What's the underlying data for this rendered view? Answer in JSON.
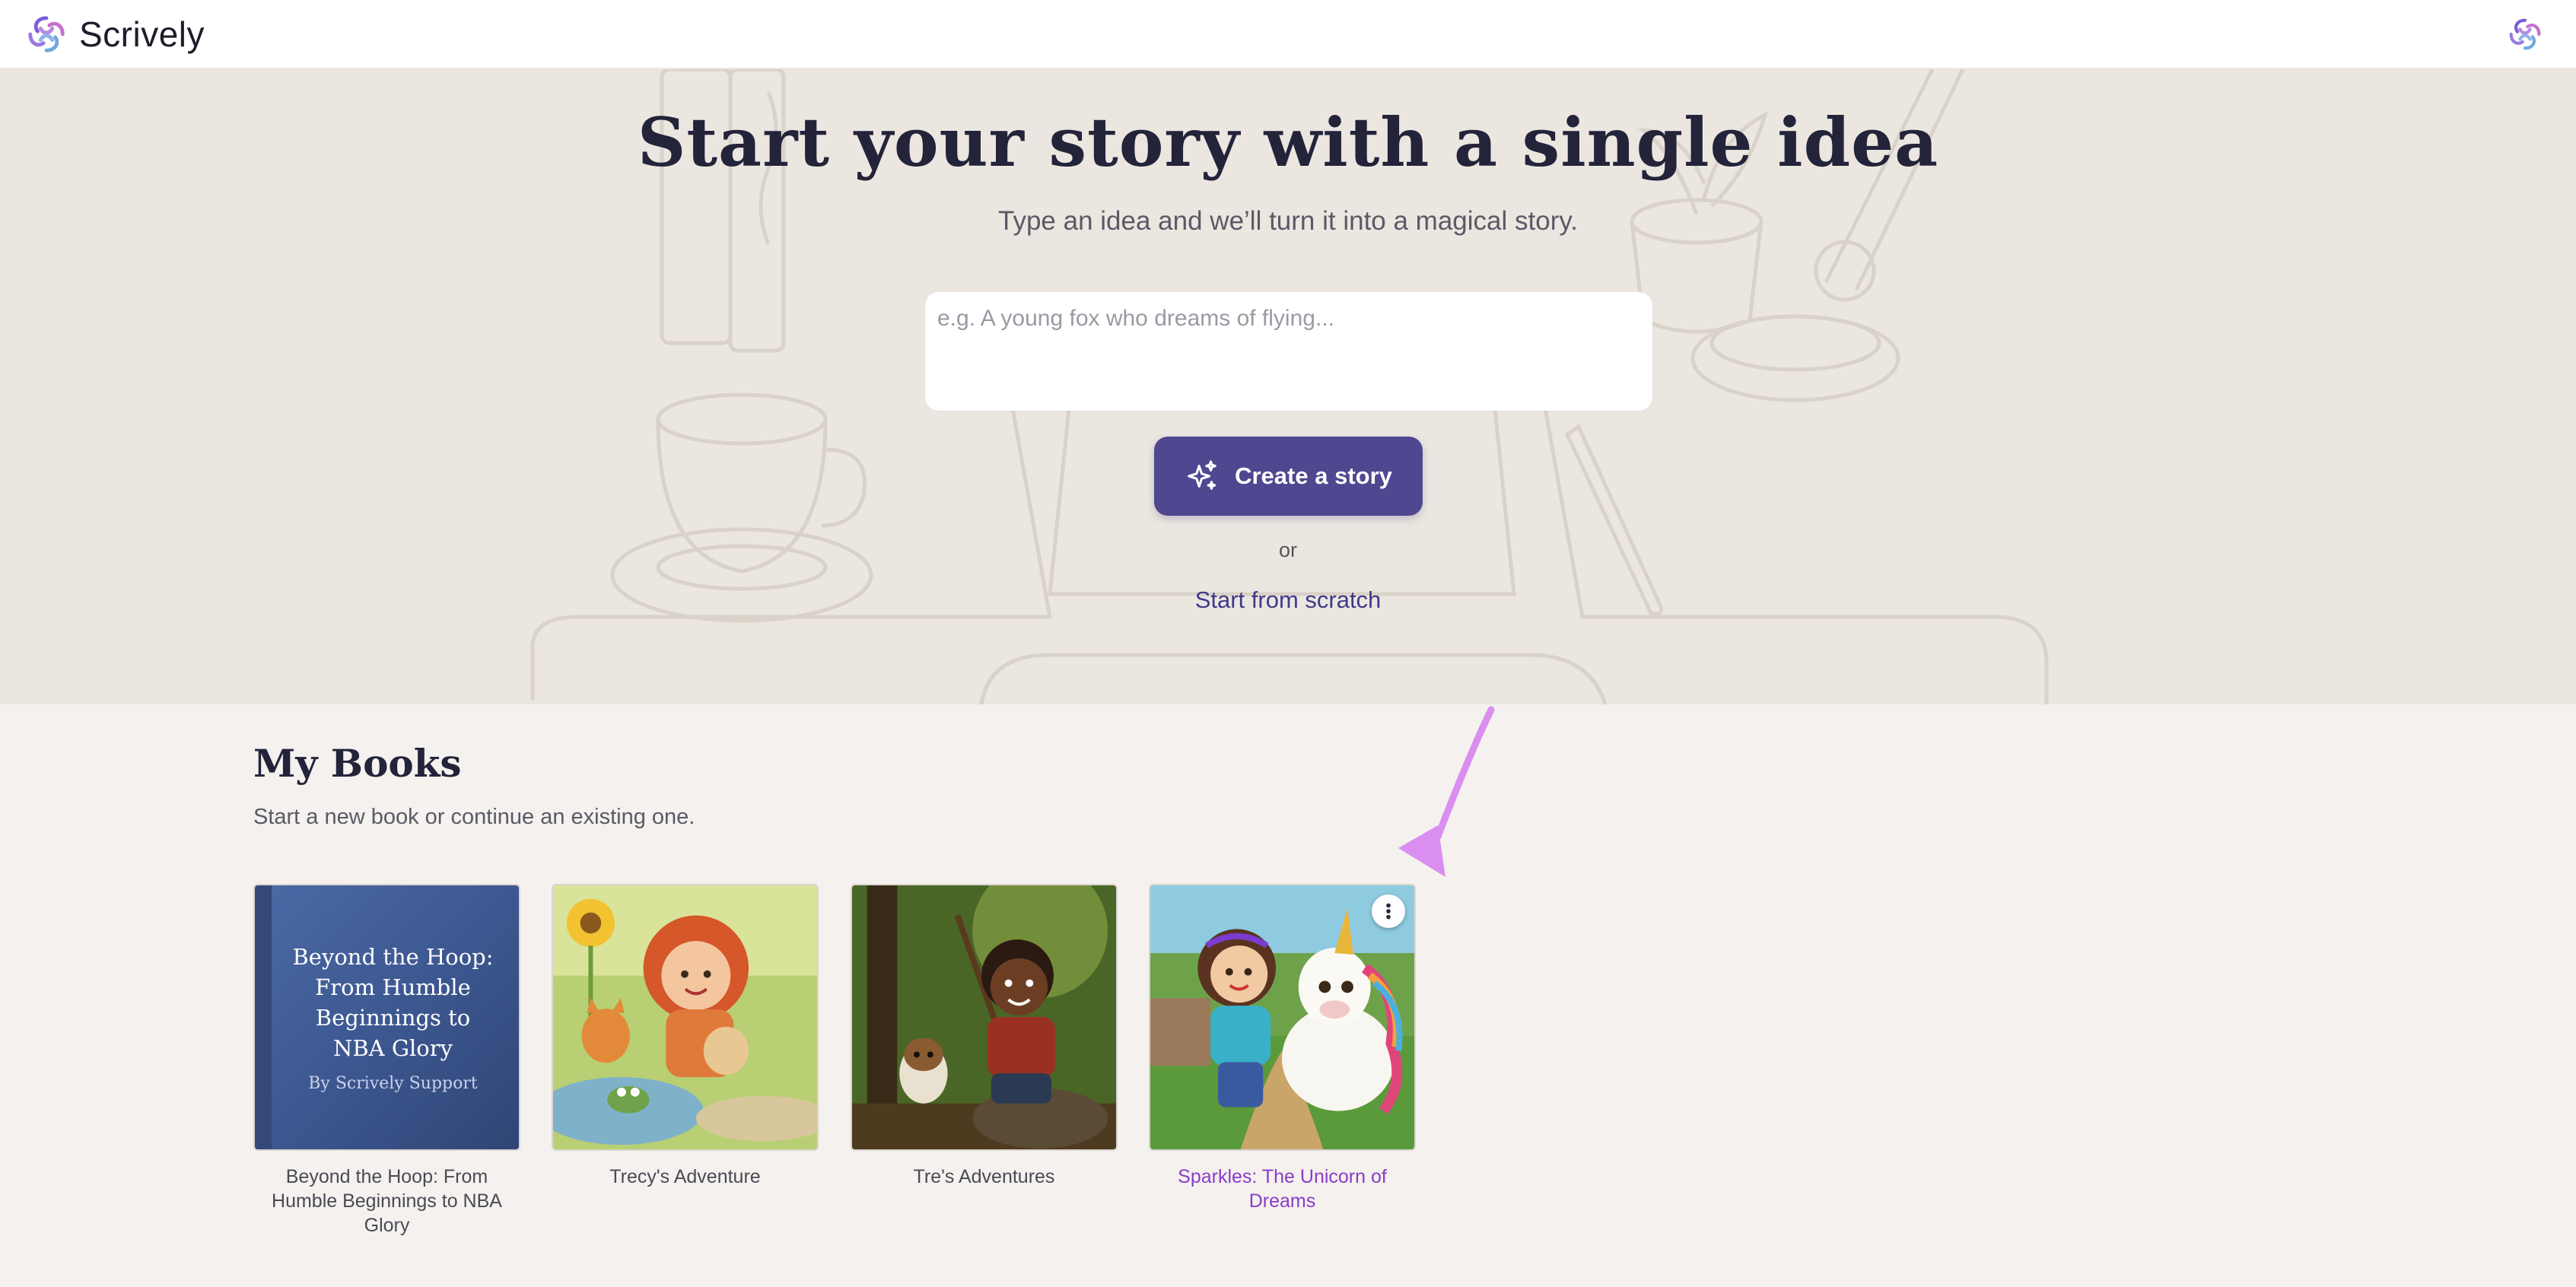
{
  "header": {
    "brand_name": "Scrively",
    "logo_icon": "swirl-logo-icon",
    "accent_colors": [
      "#7b5cd6",
      "#c66fd0",
      "#6ea8e0"
    ]
  },
  "hero": {
    "title": "Start your story with a single idea",
    "subtitle": "Type an idea and we’ll turn it into a magical story.",
    "idea_placeholder": "e.g. A young fox who dreams of flying...",
    "idea_value": "",
    "create_button_label": "Create a story",
    "create_button_icon": "sparkle-icon",
    "or_label": "or",
    "scratch_link_label": "Start from scratch"
  },
  "books_section": {
    "title": "My Books",
    "subtitle": "Start a new book or continue an existing one.",
    "books": [
      {
        "caption": "Beyond the Hoop: From Humble Beginnings to NBA Glory",
        "cover_type": "text",
        "cover_title": "Beyond the Hoop: From Humble Beginnings to NBA Glory",
        "cover_author": "By Scrively Support"
      },
      {
        "caption": "Trecy's Adventure",
        "cover_type": "illustration"
      },
      {
        "caption": "Tre's Adventures",
        "cover_type": "illustration"
      },
      {
        "caption": "Sparkles: The Unicorn of Dreams",
        "cover_type": "illustration",
        "hovered": true,
        "menu_icon": "more-vertical-icon"
      }
    ]
  },
  "annotation": {
    "arrow_color": "#d98ef0"
  },
  "colors": {
    "primary": "#4f4790",
    "link": "#3f3a8a",
    "active_caption": "#8a3cc8"
  }
}
